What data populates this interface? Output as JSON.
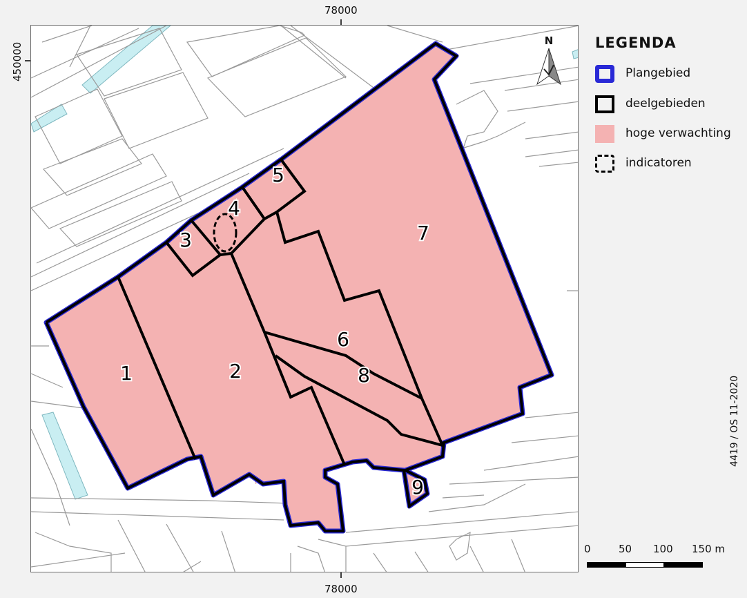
{
  "coordinates": {
    "x_top": "78000",
    "x_bottom": "78000",
    "y_left": "450000"
  },
  "north_arrow": {
    "letter": "N"
  },
  "legend": {
    "title": "LEGENDA",
    "items": [
      {
        "label": "Plangebied",
        "symbol": "blue-outline-square",
        "color": "#2929d6"
      },
      {
        "label": "deelgebieden",
        "symbol": "black-outline-square",
        "color": "#000000"
      },
      {
        "label": "hoge verwachting",
        "symbol": "pink-fill-square",
        "color": "#f4b2b2"
      },
      {
        "label": "indicatoren",
        "symbol": "dashed-outline-square",
        "color": "#000000"
      }
    ]
  },
  "subareas": [
    "1",
    "2",
    "3",
    "4",
    "5",
    "6",
    "7",
    "8",
    "9"
  ],
  "scale_bar": {
    "labels": [
      "0",
      "50",
      "100",
      "150 m"
    ]
  },
  "credit": "4419 / OS 11-2020",
  "colors": {
    "plan_area_outline": "#2929d6",
    "high_expectation_fill": "#f4b2b2",
    "water": "#c9eef2",
    "streets": "#9a9a9a"
  }
}
